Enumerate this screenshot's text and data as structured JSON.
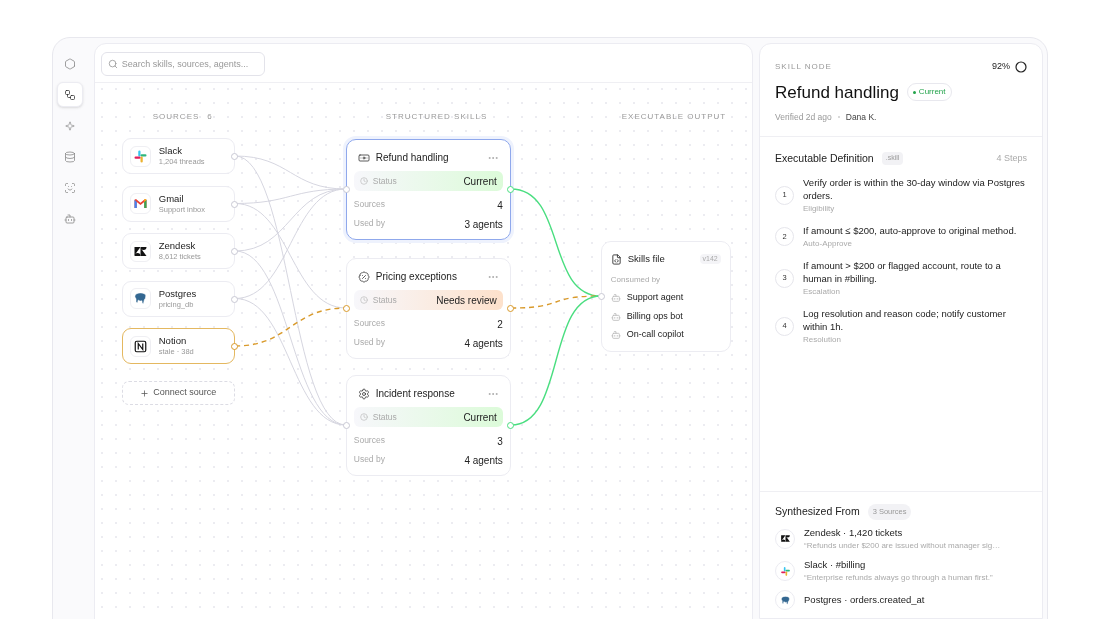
{
  "nav": [
    {
      "selected": false
    },
    {
      "selected": true
    },
    {
      "selected": false
    },
    {
      "selected": false
    },
    {
      "selected": false
    },
    {
      "selected": false
    }
  ],
  "search": {
    "placeholder": "Search skills, sources, agents..."
  },
  "columns": {
    "sources_title": "SOURCES",
    "sources_count": "6",
    "skills_title": "STRUCTURED SKILLS",
    "output_title": "EXECUTABLE OUTPUT"
  },
  "sources": [
    {
      "kind": "slack",
      "name": "Slack",
      "detail": "1,204 threads",
      "stale": false
    },
    {
      "kind": "gmail",
      "name": "Gmail",
      "detail": "Support inbox",
      "stale": false
    },
    {
      "kind": "zendesk",
      "name": "Zendesk",
      "detail": "8,612 tickets",
      "stale": false
    },
    {
      "kind": "postgres",
      "name": "Postgres",
      "detail": "pricing_db",
      "stale": false
    },
    {
      "kind": "notion",
      "name": "Notion",
      "detail": "stale · 38d",
      "stale": true
    }
  ],
  "connect_button": {
    "label": "Connect source"
  },
  "skills": [
    {
      "kind": "refund",
      "title": "Refund handling",
      "selected": true,
      "status_label": "Status",
      "status": "Current",
      "needs_review": false,
      "sources_label": "Sources",
      "sources": "4",
      "used_label": "Used by",
      "used": "3 agents"
    },
    {
      "kind": "pricing",
      "title": "Pricing exceptions",
      "selected": false,
      "status_label": "Status",
      "status": "Needs review",
      "needs_review": true,
      "sources_label": "Sources",
      "sources": "2",
      "used_label": "Used by",
      "used": "4 agents"
    },
    {
      "kind": "incident",
      "title": "Incident response",
      "selected": false,
      "status_label": "Status",
      "status": "Current",
      "needs_review": false,
      "sources_label": "Sources",
      "sources": "3",
      "used_label": "Used by",
      "used": "4 agents"
    }
  ],
  "output": {
    "title": "Skills file",
    "version": "v142",
    "consumed_label": "Consumed by",
    "consumers": [
      "Support agent",
      "Billing ops bot",
      "On-call copilot"
    ]
  },
  "detail": {
    "eyebrow": "SKILL NODE",
    "score": "92%",
    "title": "Refund handling",
    "badge": "Current",
    "verified": "Verified 2d ago",
    "author": "Dana K.",
    "definition_title": "Executable Definition",
    "definition_tag": ".skill",
    "steps_count": "4 Steps",
    "steps": [
      {
        "number": "1",
        "text": "Verify order is within the 30-day window via Postgres orders.",
        "label": "Eligibility"
      },
      {
        "number": "2",
        "text": "If amount ≤ $200, auto-approve to original method.",
        "label": "Auto-Approve"
      },
      {
        "number": "3",
        "text": "If amount > $200 or flagged account, route to a human in #billing.",
        "label": "Escalation"
      },
      {
        "number": "4",
        "text": "Log resolution and reason code; notify customer within 1h.",
        "label": "Resolution"
      }
    ],
    "synth_title": "Synthesized From",
    "synth_count": "3 Sources",
    "synth": [
      {
        "kind": "zendesk",
        "title": "Zendesk · 1,420 tickets",
        "quote": "“Refunds under $200 are issued without manager sig…"
      },
      {
        "kind": "slack",
        "title": "Slack · #billing",
        "quote": "“Enterprise refunds always go through a human first.”"
      },
      {
        "kind": "postgres",
        "title": "Postgres · orders.created_at"
      }
    ]
  }
}
